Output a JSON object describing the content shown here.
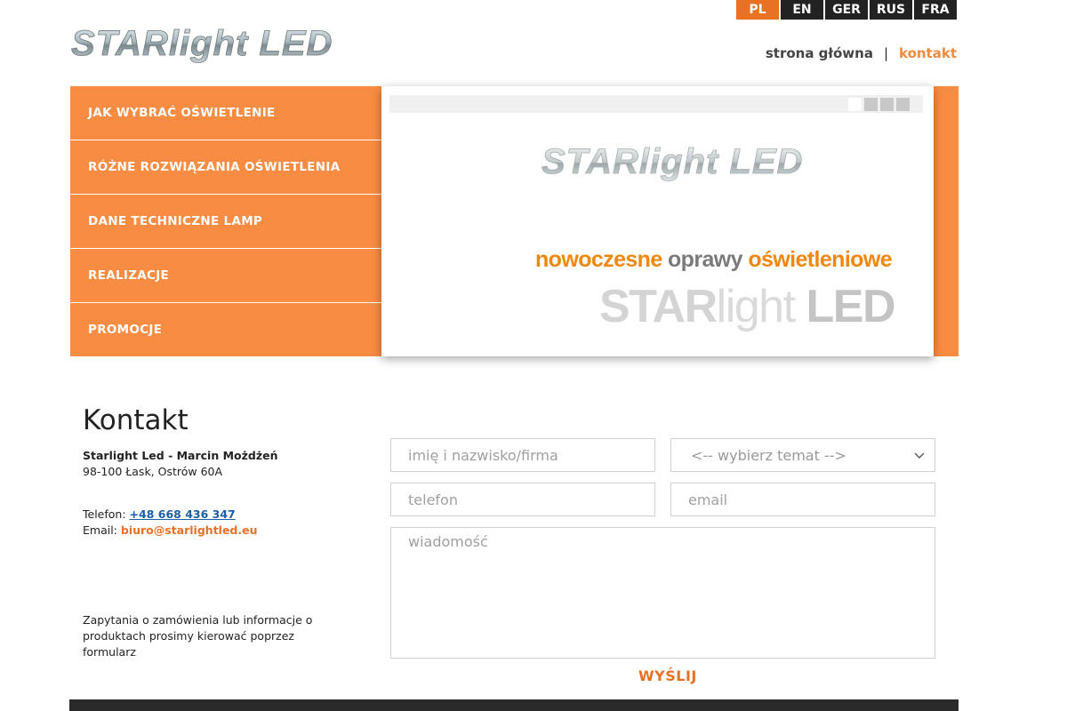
{
  "languages": [
    {
      "label": "PL",
      "active": true
    },
    {
      "label": "EN",
      "active": false
    },
    {
      "label": "GER",
      "active": false
    },
    {
      "label": "RUS",
      "active": false
    },
    {
      "label": "FRA",
      "active": false
    }
  ],
  "logo_text": "STARlight LED",
  "top_nav": {
    "home": "strona główna",
    "separator": "|",
    "contact": "kontakt"
  },
  "menu": [
    "JAK WYBRAĆ OŚWIETLENIE",
    "RÓŻNE ROZWIĄZANIA OŚWIETLENIA",
    "DANE TECHNICZNE LAMP",
    "REALIZACJE",
    "PROMOCJE"
  ],
  "slider": {
    "logo_text": "STARlight LED",
    "tagline": {
      "w1": "nowoczesne",
      "w2": "oprawy",
      "w3": "oświetleniowe"
    },
    "brand": {
      "p1": "STAR",
      "p2": "light",
      "p3": "LED"
    },
    "dots": 4,
    "active_dot": 0
  },
  "contact": {
    "title": "Kontakt",
    "company": "Starlight Led - Marcin Możdżeń",
    "address": "98-100 Łask, Ostrów 60A",
    "phone_label": "Telefon: ",
    "phone": "+48 668 436 347",
    "email_label": "Email: ",
    "email": "biuro@starlightled.eu",
    "note": "Zapytania o zamówienia lub informacje o produktach prosimy kierować poprzez formularz"
  },
  "form": {
    "name_placeholder": "imię i nazwisko/firma",
    "topic_selected": "<-- wybierz temat -->",
    "phone_placeholder": "telefon",
    "email_placeholder": "email",
    "message_placeholder": "wiadomość",
    "submit_label": "WYŚLIJ"
  },
  "colors": {
    "orange": "#f98c43",
    "accent": "#e87124",
    "dark": "#222222"
  }
}
